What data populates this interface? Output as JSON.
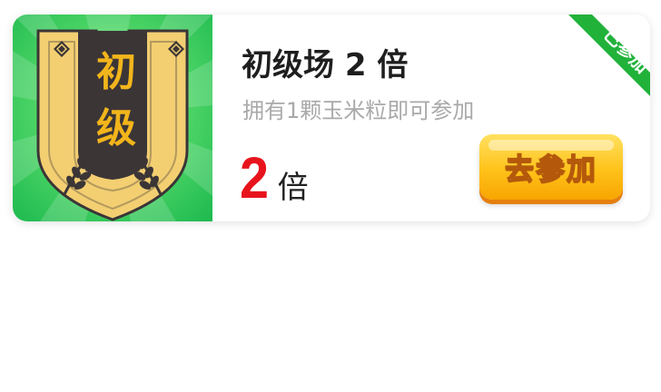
{
  "card": {
    "badge_line1": "初",
    "badge_line2": "级",
    "title": "初级场 2 倍",
    "subtitle": "拥有1颗玉米粒即可参加",
    "multiplier_value": "2",
    "multiplier_unit": "倍",
    "join_label": "去参加",
    "ribbon_label": "已参加"
  },
  "colors": {
    "badge_bg_light": "#6fe572",
    "badge_bg_dark": "#23c354",
    "shield_dark": "#3b3536",
    "shield_gold": "#f3cf72",
    "badge_text": "#f2b51b",
    "multiplier": "#e8141d",
    "button": "#ffc21a",
    "ribbon": "#21b23a"
  },
  "icons": {
    "badge": "shield-emblem-icon",
    "wheat": "wheat-icon",
    "stud": "diamond-stud-icon"
  }
}
